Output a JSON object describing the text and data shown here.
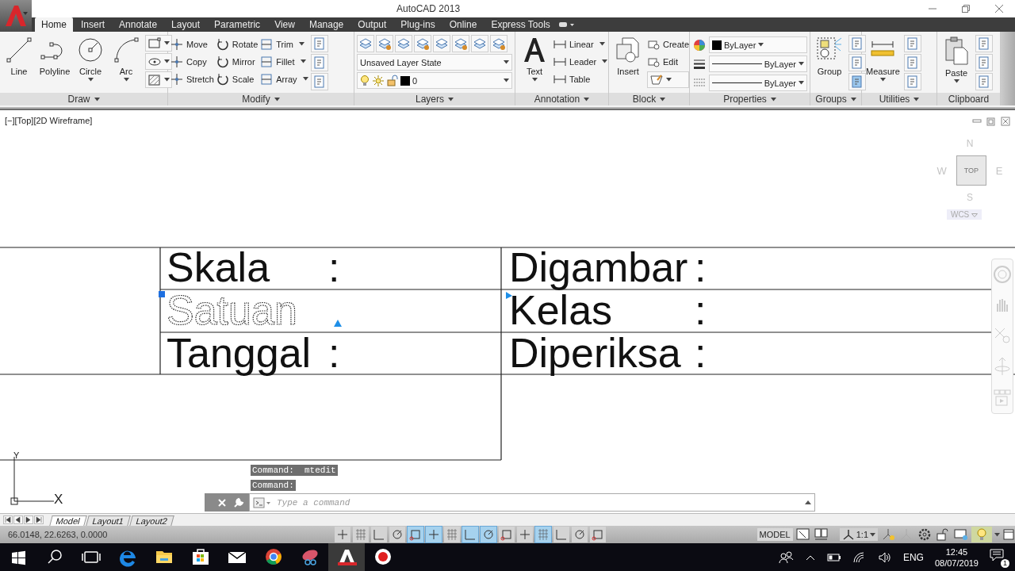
{
  "window": {
    "title": "AutoCAD 2013"
  },
  "ribbon_tabs": [
    {
      "label": "Home",
      "selected": true
    },
    {
      "label": "Insert",
      "selected": false
    },
    {
      "label": "Annotate",
      "selected": false
    },
    {
      "label": "Layout",
      "selected": false
    },
    {
      "label": "Parametric",
      "selected": false
    },
    {
      "label": "View",
      "selected": false
    },
    {
      "label": "Manage",
      "selected": false
    },
    {
      "label": "Output",
      "selected": false
    },
    {
      "label": "Plug-ins",
      "selected": false
    },
    {
      "label": "Online",
      "selected": false
    },
    {
      "label": "Express Tools",
      "selected": false
    }
  ],
  "ribbon_panels": [
    {
      "title": "Draw",
      "title_menu": true,
      "large": [
        {
          "label": "Line",
          "dropdown": false
        },
        {
          "label": "Polyline",
          "dropdown": false
        },
        {
          "label": "Circle",
          "dropdown": true
        },
        {
          "label": "Arc",
          "dropdown": true
        }
      ]
    },
    {
      "title": "Modify",
      "title_menu": true,
      "small": [
        {
          "label": "Move",
          "dropdown": false
        },
        {
          "label": "Copy",
          "dropdown": false
        },
        {
          "label": "Stretch",
          "dropdown": false
        },
        {
          "label": "Rotate",
          "dropdown": false
        },
        {
          "label": "Mirror",
          "dropdown": false
        },
        {
          "label": "Scale",
          "dropdown": false
        },
        {
          "label": "Trim",
          "dropdown": true
        },
        {
          "label": "Fillet",
          "dropdown": true
        },
        {
          "label": "Array",
          "dropdown": true
        }
      ]
    },
    {
      "title": "Layers",
      "title_menu": true,
      "dropdowns": [
        {
          "value": "Unsaved Layer State"
        },
        {
          "value": "0"
        }
      ]
    },
    {
      "title": "Annotation",
      "title_menu": true,
      "large": [
        {
          "label": "Text",
          "dropdown": true
        }
      ],
      "small": [
        {
          "label": "Linear",
          "dropdown": true
        },
        {
          "label": "Leader",
          "dropdown": true
        },
        {
          "label": "Table",
          "dropdown": false
        }
      ]
    },
    {
      "title": "Block",
      "title_menu": true,
      "large": [
        {
          "label": "Insert",
          "dropdown": false
        }
      ],
      "small": [
        {
          "label": "Create",
          "dropdown": false
        },
        {
          "label": "Edit",
          "dropdown": false
        }
      ]
    },
    {
      "title": "Properties",
      "title_menu": true,
      "dropdowns": [
        {
          "value": "ByLayer"
        },
        {
          "value": "ByLayer"
        },
        {
          "value": "ByLayer"
        }
      ]
    },
    {
      "title": "Groups",
      "title_menu": true,
      "large": [
        {
          "label": "Group",
          "dropdown": false
        }
      ]
    },
    {
      "title": "Utilities",
      "title_menu": true,
      "large": [
        {
          "label": "Measure",
          "dropdown": true
        }
      ]
    },
    {
      "title": "Clipboard",
      "title_menu": false,
      "large": [
        {
          "label": "Paste",
          "dropdown": true
        }
      ]
    }
  ],
  "viewport": {
    "label": "[−][Top][2D Wireframe]"
  },
  "view_cube": {
    "north": "N",
    "west": "W",
    "east": "E",
    "south": "S",
    "face": "TOP",
    "ucs": "WCS"
  },
  "title_block": [
    {
      "left": {
        "text": "Skala",
        "selected": false
      },
      "left_colon": ":",
      "right": {
        "text": "Digambar",
        "selected": false
      },
      "right_colon": ":"
    },
    {
      "left": {
        "text": "Satuan",
        "selected": true
      },
      "right": {
        "text": "Kelas",
        "selected": false
      },
      "right_colon": ":"
    },
    {
      "left": {
        "text": "Tanggal",
        "selected": false
      },
      "left_colon": ":",
      "right": {
        "text": "Diperiksa",
        "selected": false
      },
      "right_colon": ":"
    }
  ],
  "ucs_icon": {
    "y_label": "Y",
    "x_label": "X"
  },
  "command_history": [
    "Command:  mtedit",
    "Command:"
  ],
  "command_line": {
    "placeholder": "Type a command"
  },
  "layout_tabs": [
    {
      "label": "Model",
      "selected": true
    },
    {
      "label": "Layout1",
      "selected": false
    },
    {
      "label": "Layout2",
      "selected": false
    }
  ],
  "status_bar": {
    "coordinates": "66.0148, 22.6263, 0.0000",
    "toggles": [
      {
        "on": false
      },
      {
        "on": false
      },
      {
        "on": false
      },
      {
        "on": false
      },
      {
        "on": true
      },
      {
        "on": true
      },
      {
        "on": false
      },
      {
        "on": true
      },
      {
        "on": true
      },
      {
        "on": false
      },
      {
        "on": false
      },
      {
        "on": true
      },
      {
        "on": false
      },
      {
        "on": false
      },
      {
        "on": false
      }
    ],
    "space": "MODEL",
    "scale": "1:1"
  },
  "taskbar": {
    "language": "ENG",
    "time": "12:45",
    "date": "08/07/2019",
    "notifications": "1"
  }
}
